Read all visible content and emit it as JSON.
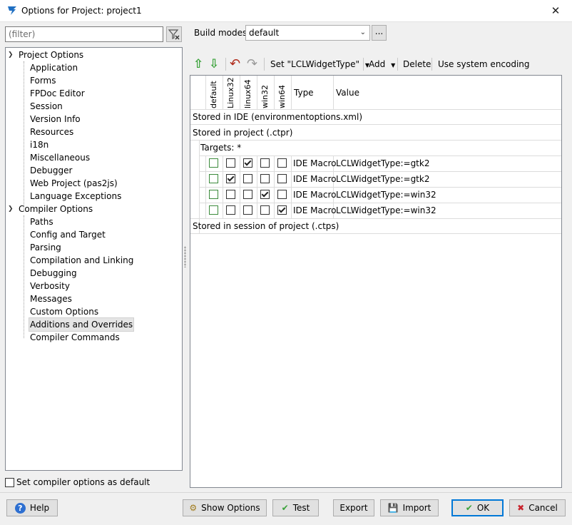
{
  "window": {
    "title": "Options for Project: project1",
    "close_glyph": "✕"
  },
  "filter": {
    "placeholder": "(filter)"
  },
  "tree": {
    "groups": [
      {
        "label": "Project Options",
        "expanded": true,
        "items": [
          "Application",
          "Forms",
          "FPDoc Editor",
          "Session",
          "Version Info",
          "Resources",
          "i18n",
          "Miscellaneous",
          "Debugger",
          "Web Project (pas2js)",
          "Language Exceptions"
        ]
      },
      {
        "label": "Compiler Options",
        "expanded": true,
        "items": [
          "Paths",
          "Config and Target",
          "Parsing",
          "Compilation and Linking",
          "Debugging",
          "Verbosity",
          "Messages",
          "Custom Options",
          "Additions and Overrides",
          "Compiler Commands"
        ]
      }
    ],
    "selected": "Additions and Overrides"
  },
  "default_checkbox": {
    "label": "Set compiler options as default",
    "checked": false
  },
  "build_modes": {
    "label": "Build modes",
    "value": "default",
    "more_label": "..."
  },
  "toolbar": {
    "set_label": "Set \"LCLWidgetType\"",
    "add_label": "Add",
    "delete_label": "Delete",
    "encoding_label": "Use system encoding"
  },
  "grid": {
    "mode_columns": [
      "default",
      "Linux32",
      "linux64",
      "win32",
      "win64"
    ],
    "type_header": "Type",
    "value_header": "Value",
    "stored_ide": "Stored in IDE (environmentoptions.xml)",
    "stored_project": "Stored in project (.ctpr)",
    "targets": "Targets: *",
    "rows": [
      {
        "checks": [
          false,
          false,
          true,
          false,
          false
        ],
        "type": "IDE Macro",
        "value": "LCLWidgetType:=gtk2"
      },
      {
        "checks": [
          false,
          true,
          false,
          false,
          false
        ],
        "type": "IDE Macro",
        "value": "LCLWidgetType:=gtk2"
      },
      {
        "checks": [
          false,
          false,
          false,
          true,
          false
        ],
        "type": "IDE Macro",
        "value": "LCLWidgetType:=win32"
      },
      {
        "checks": [
          false,
          false,
          false,
          false,
          true
        ],
        "type": "IDE Macro",
        "value": "LCLWidgetType:=win32"
      }
    ],
    "stored_session": "Stored in session of project (.ctps)"
  },
  "buttons": {
    "help": "Help",
    "show_options": "Show Options",
    "test": "Test",
    "export": "Export",
    "import": "Import",
    "ok": "OK",
    "cancel": "Cancel"
  },
  "colors": {
    "accent": "#0078d7",
    "green": "#3aa23a",
    "red": "#c8232c"
  }
}
